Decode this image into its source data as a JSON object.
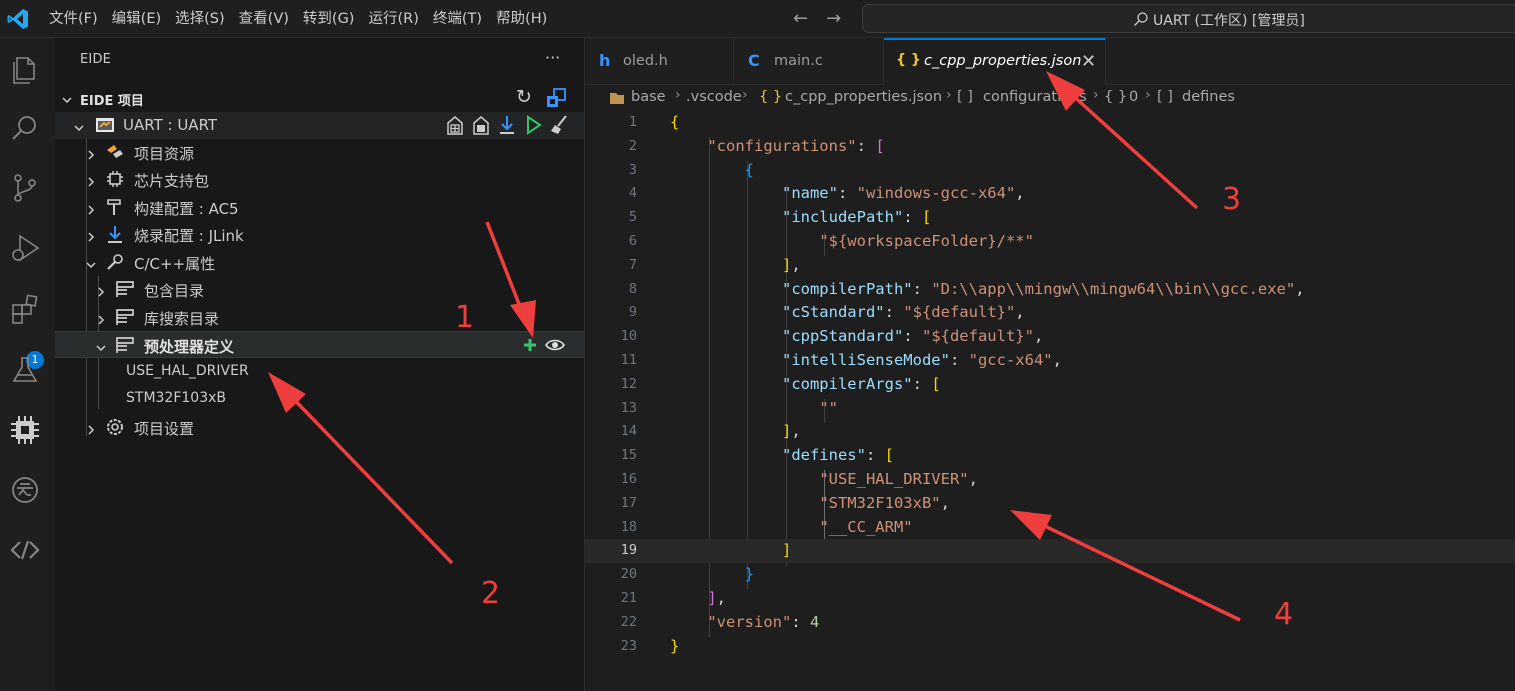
{
  "titlebar": {
    "menu": [
      "文件(F)",
      "编辑(E)",
      "选择(S)",
      "查看(V)",
      "转到(G)",
      "运行(R)",
      "终端(T)",
      "帮助(H)"
    ],
    "search_text": "UART (工作区) [管理员]"
  },
  "activitybar": {
    "items": [
      "explorer-icon",
      "search-icon",
      "source-control-icon",
      "run-debug-icon",
      "extensions-icon",
      "testing-icon",
      "eide-chip-icon",
      "cloud-icon",
      "remote-icon"
    ],
    "extensions_badge": "1"
  },
  "sidebar": {
    "title": "EIDE",
    "more": "···",
    "section_title": "EIDE 项目",
    "project": "UART : UART",
    "items": {
      "project_resources": "项目资源",
      "chip_package": "芯片支持包",
      "build_config": "构建配置 : AC5",
      "flash_config": "烧录配置 : JLink",
      "cpp_props": "C/C++属性",
      "include_dirs": "包含目录",
      "lib_dirs": "库搜索目录",
      "defines": "预处理器定义",
      "define_1": "USE_HAL_DRIVER",
      "define_2": "STM32F103xB",
      "project_settings": "项目设置"
    }
  },
  "tabs": [
    {
      "icon": "h",
      "label": "oled.h"
    },
    {
      "icon": "C",
      "label": "main.c"
    },
    {
      "icon": "{ }",
      "label": "c_cpp_properties.json",
      "close": "✕"
    }
  ],
  "breadcrumb": [
    "base",
    ".vscode",
    "{ }",
    "c_cpp_properties.json",
    "[ ]",
    "configurations",
    "{ }",
    "0",
    "[ ]",
    "defines"
  ],
  "editor": {
    "line_numbers": [
      "1",
      "2",
      "3",
      "4",
      "5",
      "6",
      "7",
      "8",
      "9",
      "10",
      "11",
      "12",
      "13",
      "14",
      "15",
      "16",
      "17",
      "18",
      "19",
      "20",
      "21",
      "22",
      "23"
    ],
    "current_line": 19,
    "code": {
      "configurations_key": "\"configurations\"",
      "name_key": "\"name\"",
      "name_val": "\"windows-gcc-x64\"",
      "includePath_key": "\"includePath\"",
      "includePath_val": "\"${workspaceFolder}/**\"",
      "compilerPath_key": "\"compilerPath\"",
      "compilerPath_val": "\"D:\\\\app\\\\mingw\\\\mingw64\\\\bin\\\\gcc.exe\"",
      "cStandard_key": "\"cStandard\"",
      "cStandard_val": "\"${default}\"",
      "cppStandard_key": "\"cppStandard\"",
      "cppStandard_val": "\"${default}\"",
      "intelliSenseMode_key": "\"intelliSenseMode\"",
      "intelliSenseMode_val": "\"gcc-x64\"",
      "compilerArgs_key": "\"compilerArgs\"",
      "compilerArgs_val": "\"\"",
      "defines_key": "\"defines\"",
      "define_1": "\"USE_HAL_DRIVER\"",
      "define_2": "\"STM32F103xB\"",
      "define_3": "\"__CC_ARM\"",
      "version_key": "\"version\"",
      "version_val": "4"
    }
  },
  "annotations": [
    "1",
    "2",
    "3",
    "4"
  ],
  "colors": {
    "accent": "#0078d4",
    "annotation": "#ee3e3e",
    "string": "#ce9178",
    "key": "#9cdcfe",
    "number": "#b5cea8"
  }
}
